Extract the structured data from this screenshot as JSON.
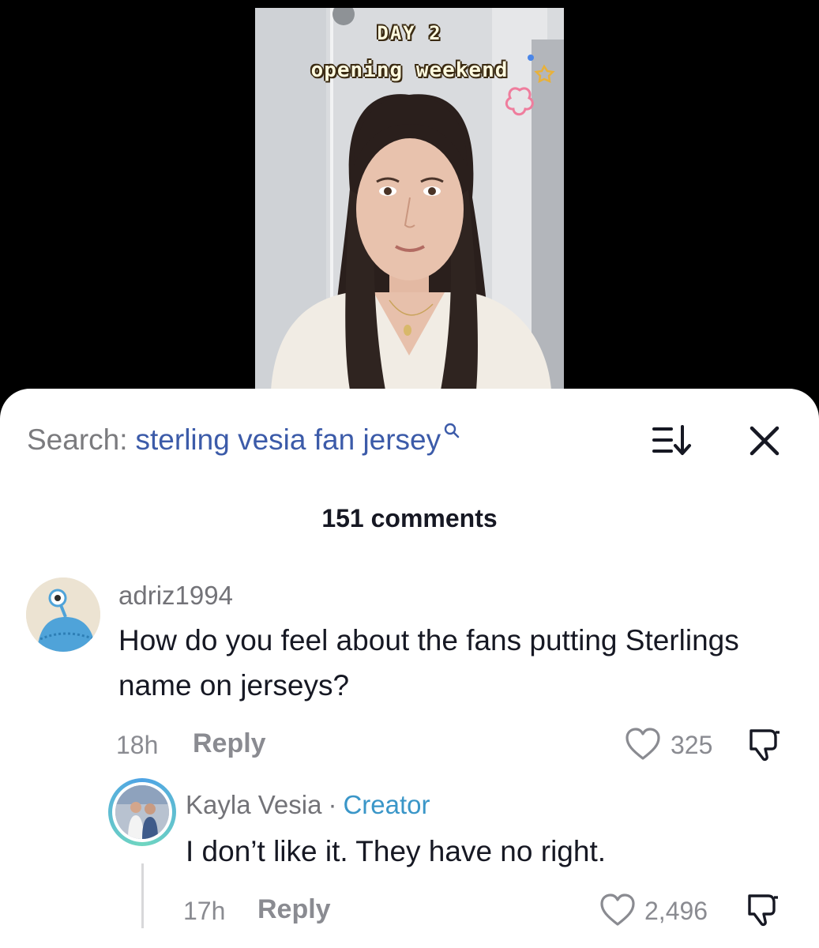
{
  "video": {
    "overlay_line1": "DAY 2",
    "overlay_line2": "opening weekend"
  },
  "search": {
    "label": "Search:",
    "query": "sterling vesia fan jersey"
  },
  "comment_count": "151 comments",
  "comments": [
    {
      "username": "adriz1994",
      "text": "How do you feel about the fans putting Sterlings name on jerseys?",
      "time": "18h",
      "reply_label": "Reply",
      "likes": "325"
    }
  ],
  "replies": [
    {
      "username": "Kayla Vesia",
      "separator": "·",
      "badge": "Creator",
      "text": "I don’t like it. They have no right.",
      "time": "17h",
      "reply_label": "Reply",
      "likes": "2,496"
    }
  ],
  "colors": {
    "search_query": "#3c5ba9",
    "creator_badge": "#3a96c8",
    "muted_text": "#8a8b91"
  }
}
